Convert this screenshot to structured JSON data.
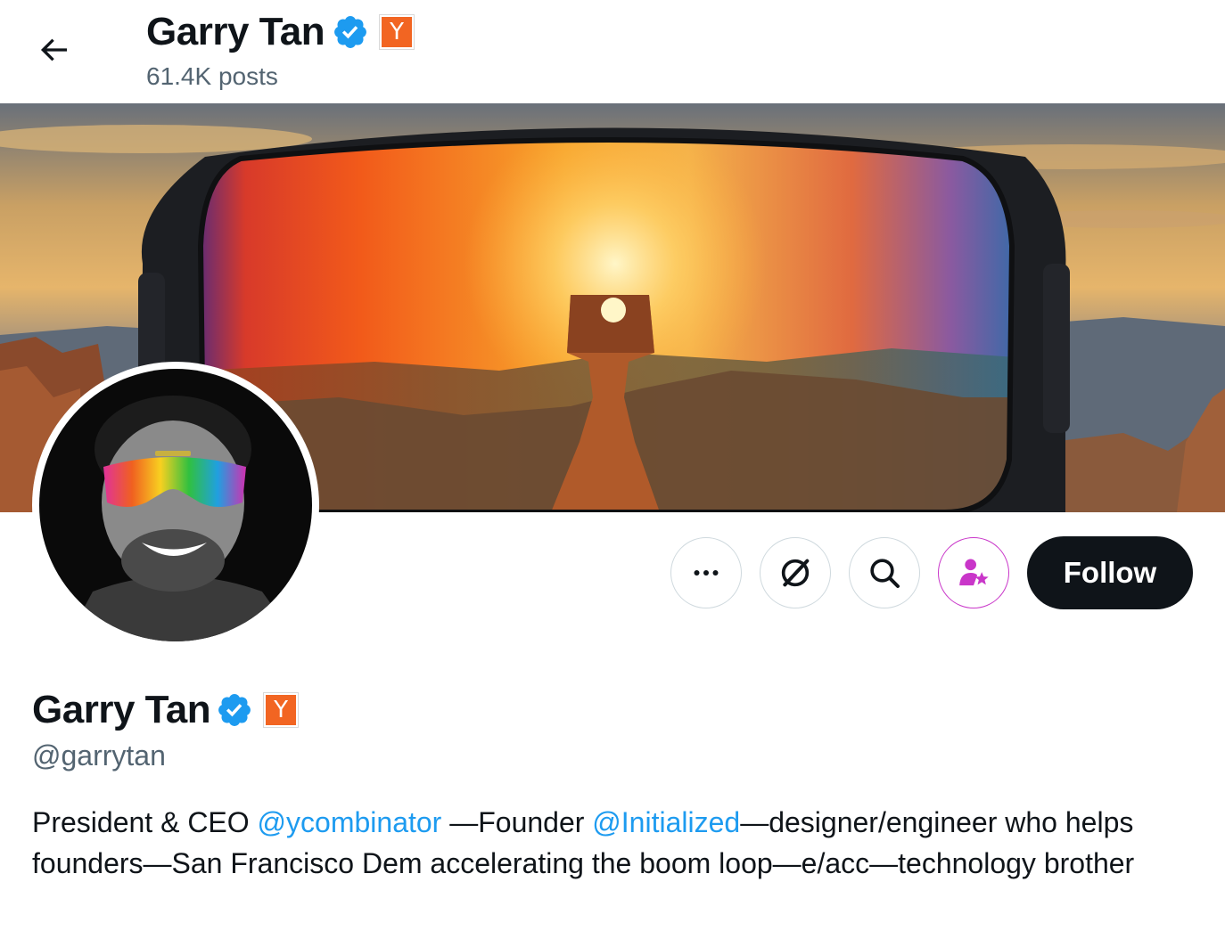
{
  "header": {
    "name": "Garry Tan",
    "posts": "61.4K posts",
    "badge_letter": "Y"
  },
  "profile": {
    "name": "Garry Tan",
    "handle": "@garrytan",
    "badge_letter": "Y",
    "bio": {
      "part1": "President & CEO ",
      "mention1": "@ycombinator",
      "part2": " —Founder ",
      "mention2": "@Initialized",
      "part3": "—designer/engineer who helps founders—San Francisco Dem accelerating the boom loop—e/acc—technology brother"
    }
  },
  "actions": {
    "follow_label": "Follow",
    "icons": [
      "more-icon",
      "grok-icon",
      "search-icon",
      "subscribe-icon"
    ]
  },
  "colors": {
    "verified": "#1d9bf0",
    "yc_orange": "#f26522",
    "follow_bg": "#0f1419",
    "mention": "#1d9bf0",
    "subscribe": "#c936c9",
    "secondary_text": "#536471"
  }
}
